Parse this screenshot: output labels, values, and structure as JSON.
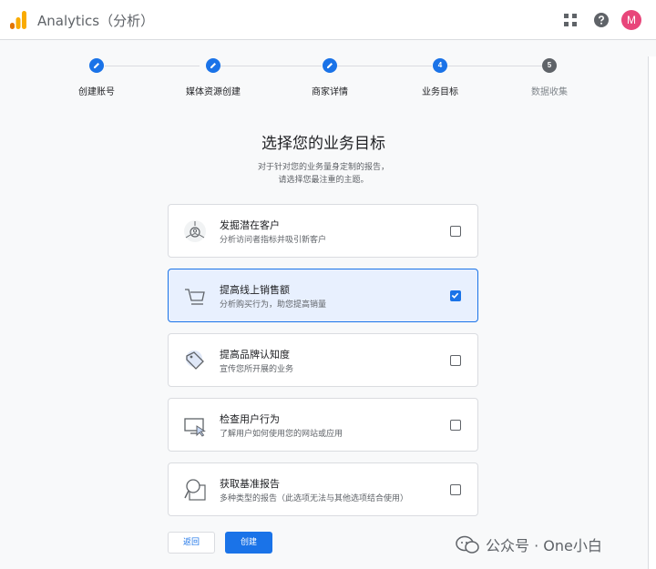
{
  "header": {
    "app_title": "Analytics（分析）",
    "avatar_letter": "M",
    "icons": [
      "analytics-logo",
      "apps-grid-icon",
      "help-icon"
    ]
  },
  "stepper": {
    "steps": [
      {
        "label": "创建账号",
        "number": "",
        "state": "done"
      },
      {
        "label": "媒体资源创建",
        "number": "",
        "state": "done"
      },
      {
        "label": "商家详情",
        "number": "",
        "state": "done"
      },
      {
        "label": "业务目标",
        "number": "4",
        "state": "current"
      },
      {
        "label": "数据收集",
        "number": "5",
        "state": "pending"
      }
    ]
  },
  "main": {
    "heading": "选择您的业务目标",
    "subtitle_line1": "对于针对您的业务量身定制的报告，",
    "subtitle_line2": "请选择您最注重的主题。"
  },
  "options": [
    {
      "title": "发掘潜在客户",
      "desc": "分析访问者指标并吸引新客户",
      "icon": "leads-icon",
      "checked": false
    },
    {
      "title": "提高线上销售额",
      "desc": "分析购买行为，助您提高销量",
      "icon": "cart-icon",
      "checked": true
    },
    {
      "title": "提高品牌认知度",
      "desc": "宣传您所开展的业务",
      "icon": "tag-icon",
      "checked": false
    },
    {
      "title": "检查用户行为",
      "desc": "了解用户如何使用您的网站或应用",
      "icon": "screen-cursor-icon",
      "checked": false
    },
    {
      "title": "获取基准报告",
      "desc": "多种类型的报告（此选项无法与其他选项结合使用）",
      "icon": "magnifier-report-icon",
      "checked": false
    }
  ],
  "footer": {
    "back_label": "返回",
    "create_label": "创建"
  },
  "watermark": {
    "text": "公众号 · One小白"
  },
  "colors": {
    "accent": "#1a73e8",
    "selected_bg": "#e8f0fe",
    "avatar": "#e8457a",
    "logo_orange": "#f9ab00",
    "logo_dark_orange": "#e37400"
  }
}
